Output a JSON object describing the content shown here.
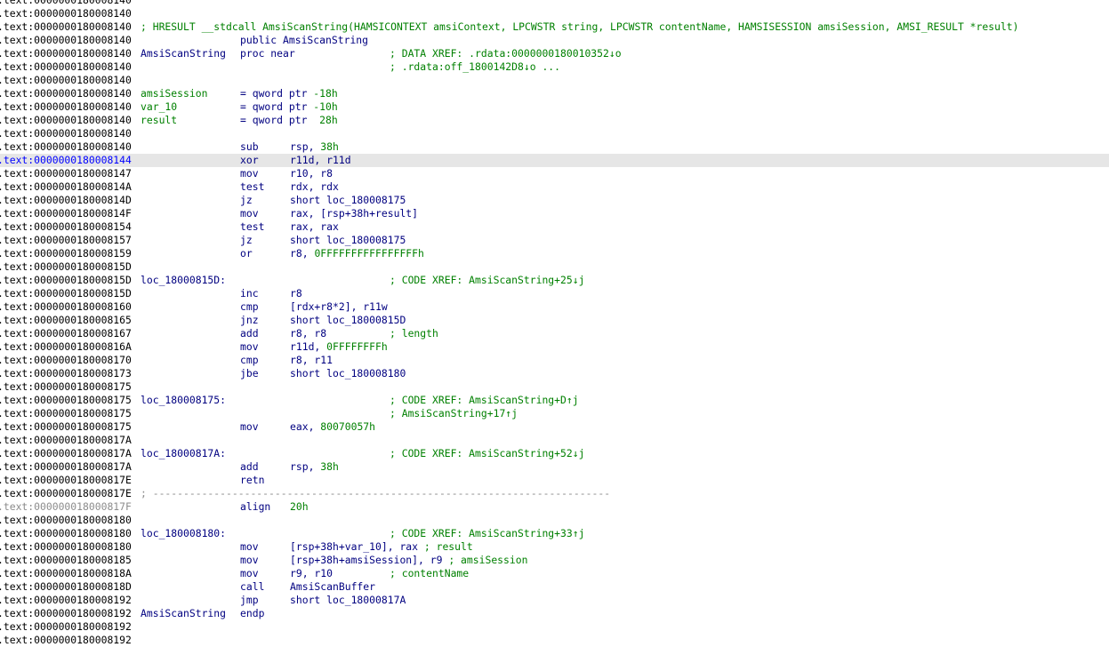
{
  "listing": [
    {
      "addr": ".text:0000000180008140",
      "kind": "blank"
    },
    {
      "addr": ".text:0000000180008140",
      "kind": "blank"
    },
    {
      "addr": ".text:0000000180008140",
      "kind": "fullcomment",
      "comment": "; HRESULT __stdcall AmsiScanString(HAMSICONTEXT amsiContext, LPCWSTR string, LPCWSTR contentName, HAMSISESSION amsiSession, AMSI_RESULT *result)"
    },
    {
      "addr": ".text:0000000180008140",
      "kind": "directive",
      "text": "public AmsiScanString"
    },
    {
      "addr": ".text:0000000180008140",
      "kind": "code",
      "label": "AmsiScanString",
      "mnem": "proc near",
      "comment": "; DATA XREF: .rdata:0000000180010352↓o"
    },
    {
      "addr": ".text:0000000180008140",
      "kind": "code",
      "comment": "; .rdata:off_1800142D8↓o ..."
    },
    {
      "addr": ".text:0000000180008140",
      "kind": "blank"
    },
    {
      "addr": ".text:0000000180008140",
      "kind": "vardecl",
      "label": "amsiSession",
      "decl": "= qword ptr -18h"
    },
    {
      "addr": ".text:0000000180008140",
      "kind": "vardecl",
      "label": "var_10",
      "decl": "= qword ptr -10h"
    },
    {
      "addr": ".text:0000000180008140",
      "kind": "vardecl",
      "label": "result",
      "decl": "= qword ptr  28h"
    },
    {
      "addr": ".text:0000000180008140",
      "kind": "blank"
    },
    {
      "addr": ".text:0000000180008140",
      "kind": "code",
      "mnem": "sub",
      "ops": "rsp, ",
      "num": "38h"
    },
    {
      "addr": ".text:0000000180008144",
      "kind": "code",
      "mnem": "xor",
      "ops": "r11d, r11d",
      "highlight": true
    },
    {
      "addr": ".text:0000000180008147",
      "kind": "code",
      "mnem": "mov",
      "ops": "r10, r8"
    },
    {
      "addr": ".text:000000018000814A",
      "kind": "code",
      "mnem": "test",
      "ops": "rdx, rdx"
    },
    {
      "addr": ".text:000000018000814D",
      "kind": "code",
      "mnem": "jz",
      "ops": "short loc_180008175"
    },
    {
      "addr": ".text:000000018000814F",
      "kind": "code",
      "mnem": "mov",
      "ops": "rax, [rsp+38h+result]"
    },
    {
      "addr": ".text:0000000180008154",
      "kind": "code",
      "mnem": "test",
      "ops": "rax, rax"
    },
    {
      "addr": ".text:0000000180008157",
      "kind": "code",
      "mnem": "jz",
      "ops": "short loc_180008175"
    },
    {
      "addr": ".text:0000000180008159",
      "kind": "code",
      "mnem": "or",
      "ops": "r8, ",
      "num": "0FFFFFFFFFFFFFFFFh"
    },
    {
      "addr": ".text:000000018000815D",
      "kind": "blank"
    },
    {
      "addr": ".text:000000018000815D",
      "kind": "code",
      "label": "loc_18000815D:",
      "comment": "; CODE XREF: AmsiScanString+25↓j"
    },
    {
      "addr": ".text:000000018000815D",
      "kind": "code",
      "mnem": "inc",
      "ops": "r8"
    },
    {
      "addr": ".text:0000000180008160",
      "kind": "code",
      "mnem": "cmp",
      "ops": "[rdx+r8*2], r11w"
    },
    {
      "addr": ".text:0000000180008165",
      "kind": "code",
      "mnem": "jnz",
      "ops": "short loc_18000815D"
    },
    {
      "addr": ".text:0000000180008167",
      "kind": "code",
      "mnem": "add",
      "ops": "r8, r8",
      "comment": "; length"
    },
    {
      "addr": ".text:000000018000816A",
      "kind": "code",
      "mnem": "mov",
      "ops": "r11d, ",
      "num": "0FFFFFFFFh"
    },
    {
      "addr": ".text:0000000180008170",
      "kind": "code",
      "mnem": "cmp",
      "ops": "r8, r11"
    },
    {
      "addr": ".text:0000000180008173",
      "kind": "code",
      "mnem": "jbe",
      "ops": "short loc_180008180"
    },
    {
      "addr": ".text:0000000180008175",
      "kind": "blank"
    },
    {
      "addr": ".text:0000000180008175",
      "kind": "code",
      "label": "loc_180008175:",
      "comment": "; CODE XREF: AmsiScanString+D↑j"
    },
    {
      "addr": ".text:0000000180008175",
      "kind": "code",
      "comment": "; AmsiScanString+17↑j"
    },
    {
      "addr": ".text:0000000180008175",
      "kind": "code",
      "mnem": "mov",
      "ops": "eax, ",
      "num": "80070057h"
    },
    {
      "addr": ".text:000000018000817A",
      "kind": "blank"
    },
    {
      "addr": ".text:000000018000817A",
      "kind": "code",
      "label": "loc_18000817A:",
      "comment": "; CODE XREF: AmsiScanString+52↓j"
    },
    {
      "addr": ".text:000000018000817A",
      "kind": "code",
      "mnem": "add",
      "ops": "rsp, ",
      "num": "38h"
    },
    {
      "addr": ".text:000000018000817E",
      "kind": "code",
      "mnem": "retn"
    },
    {
      "addr": ".text:000000018000817E",
      "kind": "separator",
      "text": "; ---------------------------------------------------------------------------"
    },
    {
      "addr": ".text:000000018000817F",
      "kind": "code",
      "mnem": "align",
      "num": "20h",
      "grey": true
    },
    {
      "addr": ".text:0000000180008180",
      "kind": "blank"
    },
    {
      "addr": ".text:0000000180008180",
      "kind": "code",
      "label": "loc_180008180:",
      "comment": "; CODE XREF: AmsiScanString+33↑j"
    },
    {
      "addr": ".text:0000000180008180",
      "kind": "code",
      "mnem": "mov",
      "ops": "[rsp+38h+var_10], rax",
      "inline": "; result"
    },
    {
      "addr": ".text:0000000180008185",
      "kind": "code",
      "mnem": "mov",
      "ops": "[rsp+38h+amsiSession], r9",
      "inline": "; amsiSession"
    },
    {
      "addr": ".text:000000018000818A",
      "kind": "code",
      "mnem": "mov",
      "ops": "r9, r10",
      "comment": "; contentName"
    },
    {
      "addr": ".text:000000018000818D",
      "kind": "code",
      "mnem": "call",
      "ops": "AmsiScanBuffer"
    },
    {
      "addr": ".text:0000000180008192",
      "kind": "code",
      "mnem": "jmp",
      "ops": "short loc_18000817A"
    },
    {
      "addr": ".text:0000000180008192",
      "kind": "code",
      "label": "AmsiScanString",
      "mnem": "endp"
    },
    {
      "addr": ".text:0000000180008192",
      "kind": "blank"
    },
    {
      "addr": ".text:0000000180008192",
      "kind": "blank"
    }
  ]
}
